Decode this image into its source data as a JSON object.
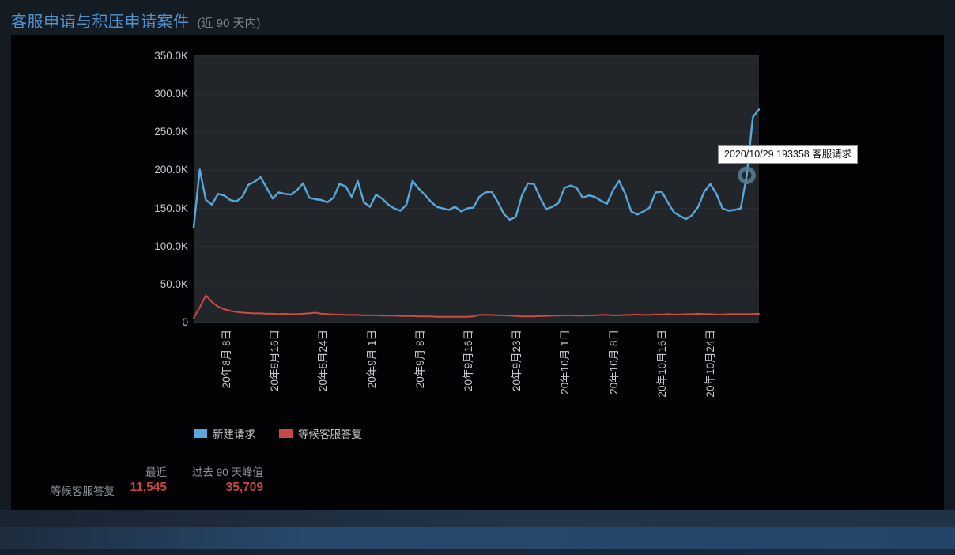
{
  "header": {
    "title": "客服申请与积压申请案件",
    "subtitle": "(近 90 天内)"
  },
  "legend": {
    "items": [
      {
        "label": "新建请求",
        "color": "#58a8dc"
      },
      {
        "label": "等候客服答复",
        "color": "#c64b42"
      }
    ]
  },
  "tooltip": {
    "text": "2020/10/29 193358 客服请求"
  },
  "summary_table": {
    "columns": [
      "最近",
      "过去 90 天峰值"
    ],
    "rows": [
      {
        "label": "等候客服答复",
        "recent": "11,545",
        "peak": "35,709"
      }
    ],
    "value_color": "#c64540"
  },
  "chart_data": {
    "type": "line",
    "title": "客服申请与积压申请案件 (近 90 天内)",
    "xlabel": "",
    "ylabel": "",
    "ylim": [
      0,
      350000
    ],
    "grid": true,
    "legend_position": "bottom",
    "plot_bg": "#22252a",
    "gridline_color": "#2c3035",
    "y_ticks": [
      {
        "label": "350.0K",
        "v": 350
      },
      {
        "label": "300.0K",
        "v": 300
      },
      {
        "label": "250.0K",
        "v": 250
      },
      {
        "label": "200.0K",
        "v": 200
      },
      {
        "label": "150.0K",
        "v": 150
      },
      {
        "label": "100.0K",
        "v": 100
      },
      {
        "label": "50.0K",
        "v": 50
      },
      {
        "label": "0",
        "v": 0
      }
    ],
    "x_ticks": [
      {
        "label": "20年8月 8日",
        "pos": 0.0587
      },
      {
        "label": "20年8月16日",
        "pos": 0.1443
      },
      {
        "label": "20年8月24日",
        "pos": 0.2299
      },
      {
        "label": "20年9月 1日",
        "pos": 0.3155
      },
      {
        "label": "20年9月 8日",
        "pos": 0.4011
      },
      {
        "label": "20年9月16日",
        "pos": 0.4867
      },
      {
        "label": "20年9月23日",
        "pos": 0.5723
      },
      {
        "label": "20年10月 1日",
        "pos": 0.6579
      },
      {
        "label": "20年10月 8日",
        "pos": 0.7435
      },
      {
        "label": "20年10月16日",
        "pos": 0.8291
      },
      {
        "label": "20年10月24日",
        "pos": 0.9147
      }
    ],
    "series": [
      {
        "name": "新建请求",
        "key": "new-requests",
        "color": "#58a8dc",
        "stroke_width": 2.4,
        "values_thousands": [
          125,
          201,
          161,
          155,
          169,
          167,
          161,
          159,
          165,
          181,
          185,
          191,
          177,
          163,
          171,
          169,
          168,
          174,
          183,
          164,
          162,
          161,
          158,
          164,
          182,
          179,
          165,
          186,
          158,
          152,
          168,
          163,
          155,
          150,
          147,
          155,
          186,
          176,
          168,
          159,
          152,
          150,
          148,
          152,
          146,
          150,
          151,
          165,
          171,
          172,
          159,
          143,
          135,
          139,
          167,
          183,
          182,
          164,
          149,
          152,
          157,
          177,
          180,
          177,
          164,
          167,
          165,
          160,
          156,
          174,
          186,
          169,
          146,
          142,
          146,
          151,
          171,
          172,
          158,
          145,
          140,
          136,
          141,
          152,
          172,
          182,
          169,
          150,
          147,
          148,
          150,
          193.358,
          270,
          280
        ]
      },
      {
        "name": "等候客服答复",
        "key": "waiting-reply",
        "color": "#cc4b44",
        "stroke_width": 2,
        "values_thousands": [
          6,
          20,
          35.709,
          27,
          21,
          17.5,
          15.5,
          14,
          13,
          12.5,
          12,
          12,
          11.5,
          11.5,
          11,
          11.5,
          11,
          11,
          11.5,
          12,
          13,
          11.5,
          11,
          10.5,
          10.5,
          10,
          10,
          10,
          9.5,
          9.5,
          9.5,
          9,
          9,
          9,
          8.5,
          8.5,
          8.5,
          8,
          8,
          8,
          7.5,
          7.5,
          7.5,
          7.5,
          7.5,
          7.5,
          8,
          10,
          10,
          10,
          9.5,
          9.5,
          9,
          8.5,
          8,
          8,
          8,
          8.5,
          8.5,
          9,
          9,
          9.5,
          9.5,
          9,
          9,
          9.5,
          9.5,
          10,
          10,
          9.5,
          9.5,
          10,
          10,
          10.5,
          10,
          10,
          10.5,
          10.5,
          11,
          10.5,
          10.5,
          11,
          11,
          11.5,
          11,
          11,
          10.5,
          10.5,
          11,
          11,
          11,
          11,
          11.2,
          11.545
        ]
      }
    ],
    "hover": {
      "date": "2020/10/29",
      "value": 193358,
      "series": "新建请求",
      "point_index": 91,
      "marker_color": "#5b7f96"
    }
  }
}
